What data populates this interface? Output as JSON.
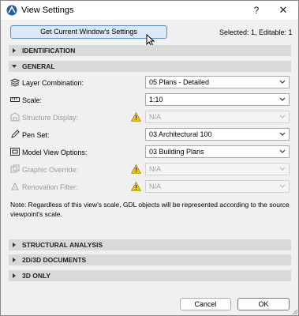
{
  "window": {
    "title": "View Settings",
    "help_label": "?",
    "close_label": "✕"
  },
  "top": {
    "get_settings_label": "Get Current Window's Settings",
    "selected_info": "Selected: 1, Editable: 1"
  },
  "sections": {
    "identification": "IDENTIFICATION",
    "general": "GENERAL",
    "structural_analysis": "STRUCTURAL ANALYSIS",
    "documents": "2D/3D DOCUMENTS",
    "only3d": "3D ONLY"
  },
  "rows": [
    {
      "label": "Layer Combination:",
      "value": "05 Plans - Detailed",
      "enabled": true,
      "warning": false,
      "icon": "layers-icon"
    },
    {
      "label": "Scale:",
      "value": "1:10",
      "enabled": true,
      "warning": false,
      "icon": "ruler-icon"
    },
    {
      "label": "Structure Display:",
      "value": "N/A",
      "enabled": false,
      "warning": true,
      "icon": "structure-icon"
    },
    {
      "label": "Pen Set:",
      "value": "03 Architectural 100",
      "enabled": true,
      "warning": false,
      "icon": "pen-icon"
    },
    {
      "label": "Model View Options:",
      "value": "03 Building Plans",
      "enabled": true,
      "warning": false,
      "icon": "model-view-icon"
    },
    {
      "label": "Graphic Override:",
      "value": "N/A",
      "enabled": false,
      "warning": true,
      "icon": "graphic-override-icon"
    },
    {
      "label": "Renovation Filter:",
      "value": "N/A",
      "enabled": false,
      "warning": true,
      "icon": "renovation-icon"
    }
  ],
  "note": "Note: Regardless of this view's scale, GDL objects will be represented according to the source viewpoint's scale.",
  "footer": {
    "cancel_label": "Cancel",
    "ok_label": "OK"
  },
  "colors": {
    "accent": "#5a8fcf",
    "section_bg": "#d9d9d9",
    "warning": "#f2c200"
  }
}
